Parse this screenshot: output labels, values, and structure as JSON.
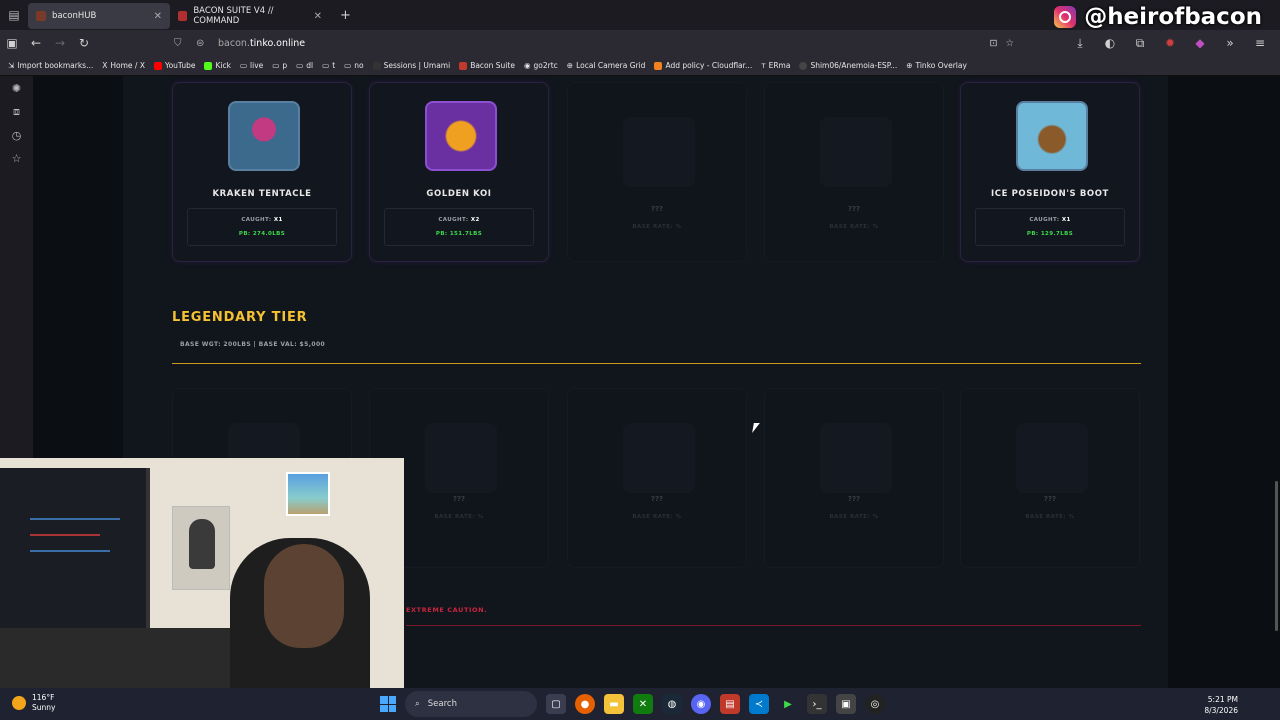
{
  "insta_handle": "@heirofbacon",
  "tabs": [
    {
      "label": "baconHUB",
      "close": "✕"
    },
    {
      "label": "BACON SUITE V4 // COMMAND",
      "close": "✕"
    }
  ],
  "new_tab": "+",
  "url": {
    "host": "bacon.",
    "domain": "tinko.online"
  },
  "bookmarks": [
    "Import bookmarks...",
    "Home / X",
    "YouTube",
    "Kick",
    "live",
    "p",
    "dl",
    "t",
    "no",
    "Sessions | Umami",
    "Bacon Suite",
    "go2rtc",
    "Local Camera Grid",
    "Add policy - Cloudflar...",
    "ERma",
    "Shim06/Anemoia-ESP...",
    "Tinko Overlay"
  ],
  "epic_row": [
    {
      "name": "KRAKEN TENTACLE",
      "caught_label": "CAUGHT:",
      "caught": "X1",
      "pb": "PB: 274.0LBS",
      "colors": [
        "#3b6a8c",
        "#c23a82"
      ]
    },
    {
      "name": "GOLDEN KOI",
      "caught_label": "CAUGHT:",
      "caught": "X2",
      "pb": "PB: 151.7LBS",
      "colors": [
        "#8b4fd0",
        "#f0a020"
      ]
    },
    {
      "name": "",
      "placeholder": "???",
      "rate": "BASE RATE: %"
    },
    {
      "name": "",
      "placeholder": "???",
      "rate": "BASE RATE: %"
    },
    {
      "name": "ICE POSEIDON'S BOOT",
      "caught_label": "CAUGHT:",
      "caught": "X1",
      "pb": "PB: 129.7LBS",
      "colors": [
        "#6fb8d8",
        "#8a5a2a"
      ]
    }
  ],
  "legendary": {
    "title": "LEGENDARY TIER",
    "meta": "BASE WGT: 200LBS   |   BASE VAL: $5,000",
    "cards": [
      {
        "placeholder": "",
        "rate": ""
      },
      {
        "placeholder": "???",
        "rate": "BASE RATE: %"
      },
      {
        "placeholder": "???",
        "rate": "BASE RATE: %"
      },
      {
        "placeholder": "???",
        "rate": "BASE RATE: %"
      },
      {
        "placeholder": "???",
        "rate": "BASE RATE: %"
      }
    ]
  },
  "warning_text": "EXTREME CAUTION.",
  "taskbar": {
    "temp": "116°F",
    "condition": "Sunny",
    "search": "Search",
    "time": "5:21 PM",
    "date": "8/3/2026"
  },
  "accent_gold": "#f5c233",
  "accent_green": "#3ddc4a",
  "accent_red": "#c7253e"
}
